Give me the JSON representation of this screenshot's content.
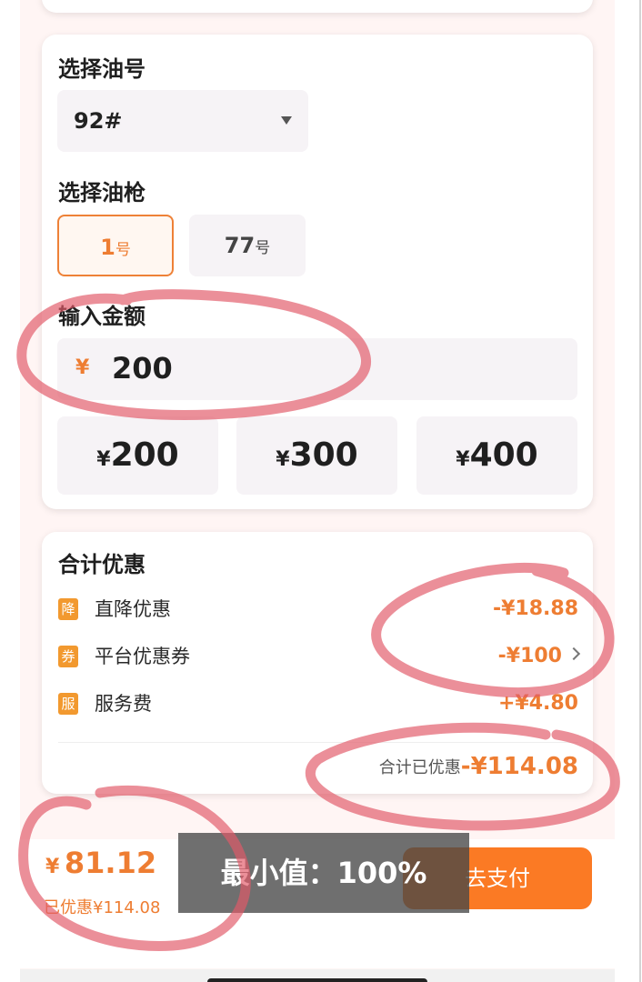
{
  "fuel": {
    "title": "选择油号",
    "selected": "92#"
  },
  "gun": {
    "title": "选择油枪",
    "options": [
      {
        "num": "1",
        "unit": "号"
      },
      {
        "num": "77",
        "unit": "号"
      }
    ]
  },
  "amount": {
    "title": "输入金额",
    "currency": "¥",
    "value": "200",
    "quick": [
      {
        "currency": "¥",
        "value": "200"
      },
      {
        "currency": "¥",
        "value": "300"
      },
      {
        "currency": "¥",
        "value": "400"
      }
    ]
  },
  "discount": {
    "title": "合计优惠",
    "rows": [
      {
        "badge": "降",
        "label": "直降优惠",
        "value": "-¥18.88"
      },
      {
        "badge": "券",
        "label": "平台优惠券",
        "value": "-¥100"
      },
      {
        "badge": "服",
        "label": "服务费",
        "value": "+¥4.80"
      }
    ],
    "total_label": "合计已优惠",
    "total_value": "-¥114.08"
  },
  "footer": {
    "currency": "¥",
    "total": "81.12",
    "saved": "已优惠¥114.08",
    "pay_label": "去支付"
  },
  "toast": "最小值：100%",
  "colors": {
    "accent": "#ee7d32",
    "button": "#fb7a24",
    "badge": "#f2992f",
    "annotation": "#e25a69"
  }
}
